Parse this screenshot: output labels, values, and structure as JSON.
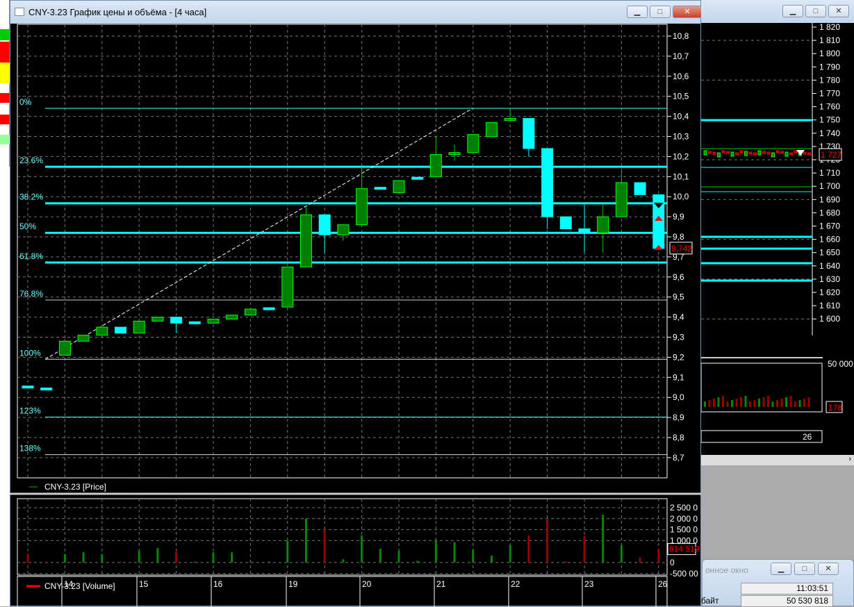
{
  "window": {
    "title": "CNY-3.23 График цены и объёма - [4 часа]",
    "min": "▁",
    "max": "□",
    "close": "✕"
  },
  "price_axis": [
    "10,8",
    "10,7",
    "10,6",
    "10,5",
    "10,4",
    "10,3",
    "10,2",
    "10,1",
    "10,0",
    "9,9",
    "9,8",
    "9,7",
    "9,6",
    "9,5",
    "9,4",
    "9,3",
    "9,2",
    "9,1",
    "9,0",
    "8,9",
    "8,8",
    "8,7"
  ],
  "last_price": "9,742",
  "price_legend": "CNY-3.23 [Price]",
  "volume_legend": "CNY-3.23 [Volume]",
  "volume_axis": [
    "2 500 0",
    "2 000 0",
    "1 500 0",
    "1 000 0",
    "0",
    "-500 00"
  ],
  "last_volume": "614 519",
  "dates": [
    "14",
    "15",
    "16",
    "19",
    "20",
    "21",
    "22",
    "23",
    "26"
  ],
  "fib_levels": [
    {
      "label": "0%",
      "price": 10.44,
      "thick": false,
      "color": "#4ff"
    },
    {
      "label": "23.6%",
      "price": 10.149,
      "thick": true,
      "color": "#0ff"
    },
    {
      "label": "38.2%",
      "price": 9.967,
      "thick": true,
      "color": "#0ff"
    },
    {
      "label": "50%",
      "price": 9.82,
      "thick": true,
      "color": "#0ff"
    },
    {
      "label": "61.8%",
      "price": 9.672,
      "thick": true,
      "color": "#0ff"
    },
    {
      "label": "76.8%",
      "price": 9.485,
      "thick": false,
      "color": "#ccc"
    },
    {
      "label": "100%",
      "price": 9.19,
      "thick": false,
      "color": "#ddd"
    },
    {
      "label": "123%",
      "price": 8.902,
      "thick": false,
      "color": "#4ff"
    },
    {
      "label": "138%",
      "price": 8.715,
      "thick": false,
      "color": "#ddd"
    }
  ],
  "chart_data": {
    "type": "candlestick",
    "title": "CNY-3.23 График цены и объёма - [4 часа]",
    "ylim": [
      8.65,
      10.85
    ],
    "candles": [
      [
        9.05,
        9.05,
        9.05,
        9.05,
        400000
      ],
      [
        9.04,
        9.04,
        9.04,
        9.04,
        30000
      ],
      [
        9.21,
        9.28,
        9.29,
        9.21,
        380000
      ],
      [
        9.28,
        9.31,
        9.31,
        9.28,
        470000
      ],
      [
        9.31,
        9.35,
        9.35,
        9.31,
        380000
      ],
      [
        9.35,
        9.32,
        9.35,
        9.32,
        50000
      ],
      [
        9.32,
        9.38,
        9.38,
        9.32,
        540000
      ],
      [
        9.38,
        9.4,
        9.4,
        9.38,
        660000
      ],
      [
        9.4,
        9.37,
        9.4,
        9.32,
        470000
      ],
      [
        9.37,
        9.37,
        9.37,
        9.37,
        30000
      ],
      [
        9.37,
        9.39,
        9.39,
        9.37,
        470000
      ],
      [
        9.39,
        9.41,
        9.41,
        9.39,
        470000
      ],
      [
        9.41,
        9.44,
        9.44,
        9.41,
        40000
      ],
      [
        9.44,
        9.44,
        9.44,
        9.44,
        40000
      ],
      [
        9.45,
        9.65,
        9.65,
        9.45,
        1000000
      ],
      [
        9.65,
        9.91,
        9.95,
        9.65,
        2000000
      ],
      [
        9.91,
        9.81,
        9.91,
        9.72,
        1500000
      ],
      [
        9.81,
        9.86,
        9.86,
        9.78,
        150000
      ],
      [
        9.86,
        10.04,
        10.15,
        9.86,
        1230000
      ],
      [
        10.04,
        10.04,
        10.04,
        10.04,
        630000
      ],
      [
        10.02,
        10.08,
        10.08,
        10.02,
        540000
      ],
      [
        10.09,
        10.09,
        10.09,
        10.09,
        80000
      ],
      [
        10.1,
        10.21,
        10.3,
        10.1,
        980000
      ],
      [
        10.21,
        10.22,
        10.26,
        10.18,
        920000
      ],
      [
        10.22,
        10.31,
        10.31,
        10.22,
        570000
      ],
      [
        10.3,
        10.37,
        10.37,
        10.3,
        320000
      ],
      [
        10.38,
        10.39,
        10.44,
        10.38,
        790000
      ],
      [
        10.39,
        10.24,
        10.39,
        10.2,
        1230000
      ],
      [
        10.24,
        9.9,
        10.24,
        9.84,
        1960000
      ],
      [
        9.9,
        9.84,
        9.9,
        9.84,
        60000
      ],
      [
        9.84,
        9.82,
        9.96,
        9.72,
        1200000
      ],
      [
        9.82,
        9.9,
        9.96,
        9.72,
        2180000
      ],
      [
        9.9,
        10.07,
        10.13,
        9.9,
        790000
      ],
      [
        10.07,
        10.01,
        10.07,
        10.01,
        220000
      ],
      [
        10.01,
        9.742,
        10.01,
        9.742,
        614519
      ]
    ],
    "candle_fields": [
      "open",
      "close",
      "high",
      "low",
      "volume"
    ]
  },
  "right_chart": {
    "axis": [
      "1 820",
      "1 810",
      "1 800",
      "1 790",
      "1 780",
      "1 770",
      "1 760",
      "1 750",
      "1 740",
      "1 730",
      "1 720",
      "1 710",
      "1 700",
      "1 690",
      "1 680",
      "1 670",
      "1 660",
      "1 650",
      "1 640",
      "1 630",
      "1 620",
      "1 610",
      "1 600"
    ],
    "last_price": "1 727",
    "volume_top": "50 000",
    "last_volume": "178",
    "date": "26"
  },
  "dialog": {
    "title": "онное окно",
    "time": "11:03:51",
    "bytes_label": "байт",
    "bytes": "50 530 818"
  }
}
